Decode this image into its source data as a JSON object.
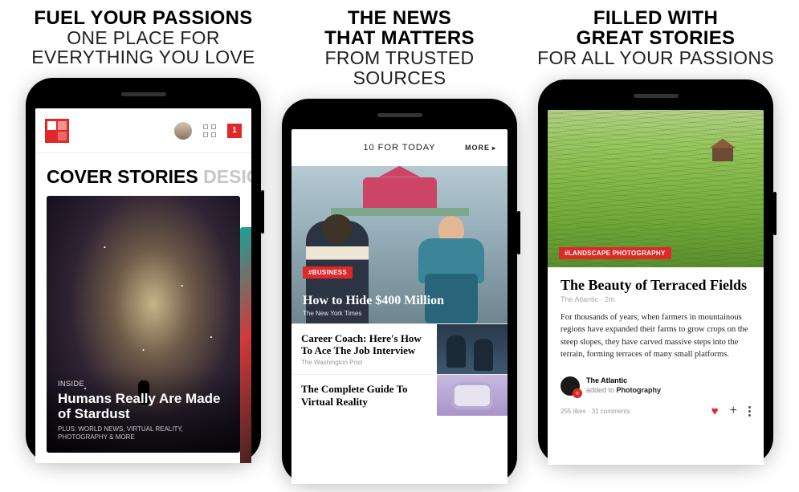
{
  "panels": [
    {
      "headline_bold1": "FUEL YOUR PASSIONS",
      "headline_thin1": "ONE PLACE FOR",
      "headline_thin2": "EVERYTHING YOU LOVE",
      "header": {
        "badge": "1"
      },
      "tabs": {
        "active": "COVER STORIES",
        "inactive": " DESIGN TECH"
      },
      "hero": {
        "label": "INSIDE",
        "title": "Humans Really Are Made of Stardust",
        "sub": "PLUS: WORLD NEWS, VIRTUAL REALITY, PHOTOGRAPHY & MORE"
      }
    },
    {
      "headline_bold1": "THE NEWS",
      "headline_bold2": "THAT MATTERS",
      "headline_thin1": "FROM TRUSTED SOURCES",
      "top": {
        "title": "10 FOR TODAY",
        "more": "MORE"
      },
      "hero": {
        "badge": "#BUSINESS",
        "title": "How to Hide $400 Million",
        "source": "The New York Times"
      },
      "rows": [
        {
          "title": "Career Coach: Here's How To Ace The Job Interview",
          "source": "The Washington Post"
        },
        {
          "title": "The Complete Guide To Virtual Reality",
          "source": ""
        }
      ]
    },
    {
      "headline_bold1": "FILLED WITH",
      "headline_bold2": "GREAT STORIES",
      "headline_thin1": "FOR ALL YOUR PASSIONS",
      "badge": "#LANDSCAPE PHOTOGRAPHY",
      "article": {
        "title": "The Beauty of Terraced Fields",
        "meta": "The Atlantic · 2m",
        "body": "For thousands of years, when farmers in mountainous regions have expanded their farms to grow crops on the steep slopes, they have carved massive steps into the terrain, forming terraces of many small platforms."
      },
      "author": {
        "name": "The Atlantic",
        "action": "added to ",
        "topic": "Photography"
      },
      "foot": {
        "likes": "255 likes",
        "comments": "31 comments"
      }
    }
  ]
}
